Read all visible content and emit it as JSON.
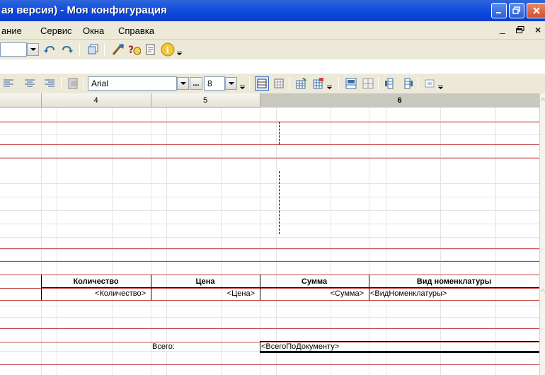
{
  "window": {
    "title": "ая версия) - Моя конфигурация"
  },
  "menu": {
    "items": [
      "ание",
      "Сервис",
      "Окна",
      "Справка"
    ]
  },
  "format_toolbar": {
    "font_name": "Arial",
    "font_size": "8",
    "more_label": "..."
  },
  "ruler": {
    "columns": [
      "4",
      "5",
      "6"
    ]
  },
  "table": {
    "headers": [
      "Количество",
      "Цена",
      "Сумма",
      "Вид номенклатуры"
    ],
    "row": [
      "<Количество>",
      "<Цена>",
      "<Сумма>",
      "<ВидНоменклатуры>"
    ]
  },
  "totals": {
    "label": "Всего:",
    "value": "<ВсегоПоДокументу>"
  },
  "colors": {
    "titlebar": "#0b45d8",
    "section_line": "#c24141",
    "chrome": "#ece9d8"
  }
}
